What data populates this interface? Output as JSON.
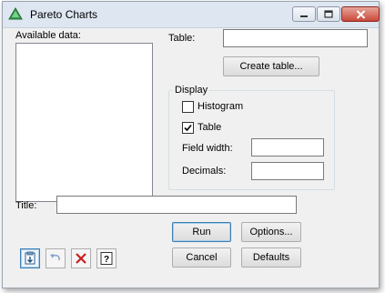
{
  "window": {
    "title": "Pareto Charts",
    "controls": {
      "minimize": "minimize",
      "maximize": "maximize",
      "close": "close"
    }
  },
  "available_data": {
    "label": "Available data:",
    "items": []
  },
  "table": {
    "label": "Table:",
    "value": ""
  },
  "create_table_button": "Create table...",
  "display": {
    "legend": "Display",
    "histogram": {
      "label": "Histogram",
      "checked": false
    },
    "table": {
      "label": "Table",
      "checked": true
    },
    "field_width": {
      "label": "Field width:",
      "value": ""
    },
    "decimals": {
      "label": "Decimals:",
      "value": ""
    }
  },
  "title_field": {
    "label": "Title:",
    "value": ""
  },
  "buttons": {
    "run": "Run",
    "options": "Options...",
    "cancel": "Cancel",
    "defaults": "Defaults"
  },
  "bottom_icons": [
    "copy-to-clipboard-icon",
    "undo-icon",
    "clear-icon",
    "help-icon"
  ],
  "colors": {
    "accent": "#3c7fb1",
    "close": "#c9483a",
    "app_icon": "#3a9e4f"
  }
}
